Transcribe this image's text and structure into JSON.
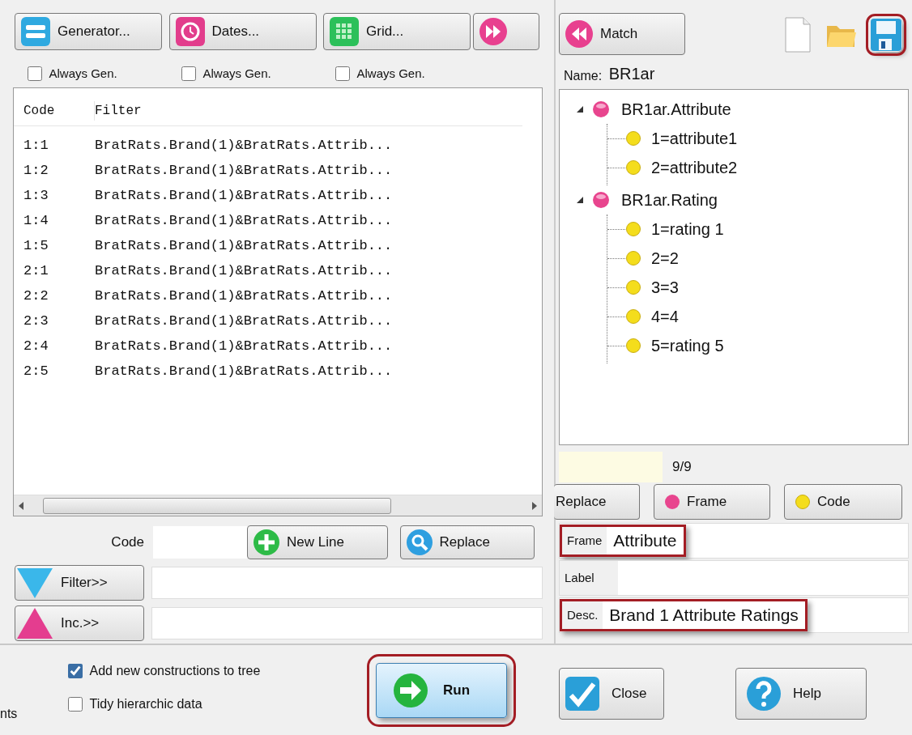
{
  "generators": [
    {
      "label": "Generator...",
      "always_gen": {
        "label": "Always Gen.",
        "checked": false
      }
    },
    {
      "label": "Dates...",
      "always_gen": {
        "label": "Always Gen.",
        "checked": false
      }
    },
    {
      "label": "Grid...",
      "always_gen": {
        "label": "Always Gen.",
        "checked": false
      }
    }
  ],
  "list": {
    "columns": [
      "Code",
      "Filter"
    ],
    "rows": [
      {
        "code": "1:1",
        "filter": "BratRats.Brand(1)&BratRats.Attrib..."
      },
      {
        "code": "1:2",
        "filter": "BratRats.Brand(1)&BratRats.Attrib..."
      },
      {
        "code": "1:3",
        "filter": "BratRats.Brand(1)&BratRats.Attrib..."
      },
      {
        "code": "1:4",
        "filter": "BratRats.Brand(1)&BratRats.Attrib..."
      },
      {
        "code": "1:5",
        "filter": "BratRats.Brand(1)&BratRats.Attrib..."
      },
      {
        "code": "2:1",
        "filter": "BratRats.Brand(1)&BratRats.Attrib..."
      },
      {
        "code": "2:2",
        "filter": "BratRats.Brand(1)&BratRats.Attrib..."
      },
      {
        "code": "2:3",
        "filter": "BratRats.Brand(1)&BratRats.Attrib..."
      },
      {
        "code": "2:4",
        "filter": "BratRats.Brand(1)&BratRats.Attrib..."
      },
      {
        "code": "2:5",
        "filter": "BratRats.Brand(1)&BratRats.Attrib..."
      }
    ]
  },
  "code_label": "Code",
  "new_line_button": {
    "label": "New Line"
  },
  "replace_button": {
    "label": "Replace"
  },
  "filter_button": {
    "label": "Filter>>"
  },
  "inc_button": {
    "label": "Inc.>>"
  },
  "options": [
    {
      "label": "Add new constructions to tree",
      "checked": true
    },
    {
      "label": "Tidy hierarchic data",
      "checked": false
    }
  ],
  "cut_text": "nts",
  "run_button": {
    "label": "Run",
    "highlighted": true
  },
  "close_button": {
    "label": "Close"
  },
  "help_button": {
    "label": "Help"
  },
  "match_button": {
    "label": "Match"
  },
  "toolbar": [
    {
      "highlighted": false
    },
    {
      "highlighted": false
    },
    {
      "highlighted": true
    }
  ],
  "name_label": "Name:",
  "name_value": "BR1ar",
  "tree": [
    {
      "label": "BR1ar.Attribute",
      "expanded": true,
      "children": [
        {
          "label": "1=attribute1"
        },
        {
          "label": "2=attribute2"
        }
      ]
    },
    {
      "label": "BR1ar.Rating",
      "expanded": true,
      "children": [
        {
          "label": "1=rating 1"
        },
        {
          "label": "2=2"
        },
        {
          "label": "3=3"
        },
        {
          "label": "4=4"
        },
        {
          "label": "5=rating 5"
        }
      ]
    }
  ],
  "counter": "9/9",
  "tree_buttons": [
    {
      "label": "Replace"
    },
    {
      "label": "Frame"
    },
    {
      "label": "Code"
    }
  ],
  "fields": [
    {
      "label": "Frame",
      "value": "Attribute",
      "highlighted": true
    },
    {
      "label": "Label"
    },
    {
      "label": "Desc.",
      "value": "Brand 1 Attribute Ratings",
      "highlighted": true
    }
  ]
}
